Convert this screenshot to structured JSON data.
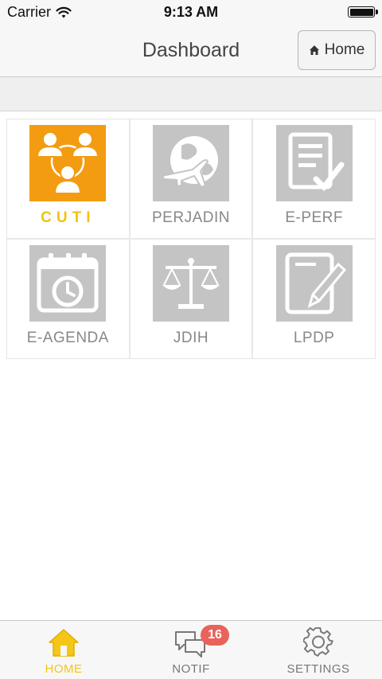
{
  "status_bar": {
    "carrier": "Carrier",
    "time": "9:13 AM"
  },
  "navbar": {
    "title": "Dashboard",
    "home_button": "Home"
  },
  "tiles": [
    {
      "label": "CUTI",
      "icon": "people-network-icon",
      "active": true
    },
    {
      "label": "PERJADIN",
      "icon": "globe-plane-icon",
      "active": false
    },
    {
      "label": "E-PERF",
      "icon": "document-check-icon",
      "active": false
    },
    {
      "label": "E-AGENDA",
      "icon": "calendar-clock-icon",
      "active": false
    },
    {
      "label": "JDIH",
      "icon": "scales-icon",
      "active": false
    },
    {
      "label": "LPDP",
      "icon": "notepad-pencil-icon",
      "active": false
    }
  ],
  "tabbar": {
    "home": {
      "label": "HOME",
      "icon": "house-icon"
    },
    "notif": {
      "label": "NOTIF",
      "icon": "chat-bubbles-icon",
      "badge": "16"
    },
    "settings": {
      "label": "SETTINGS",
      "icon": "gear-icon"
    }
  },
  "colors": {
    "accent_orange": "#f39c12",
    "accent_yellow": "#f5c518",
    "tile_gray": "#c4c4c4",
    "badge_red": "#e8635b"
  }
}
